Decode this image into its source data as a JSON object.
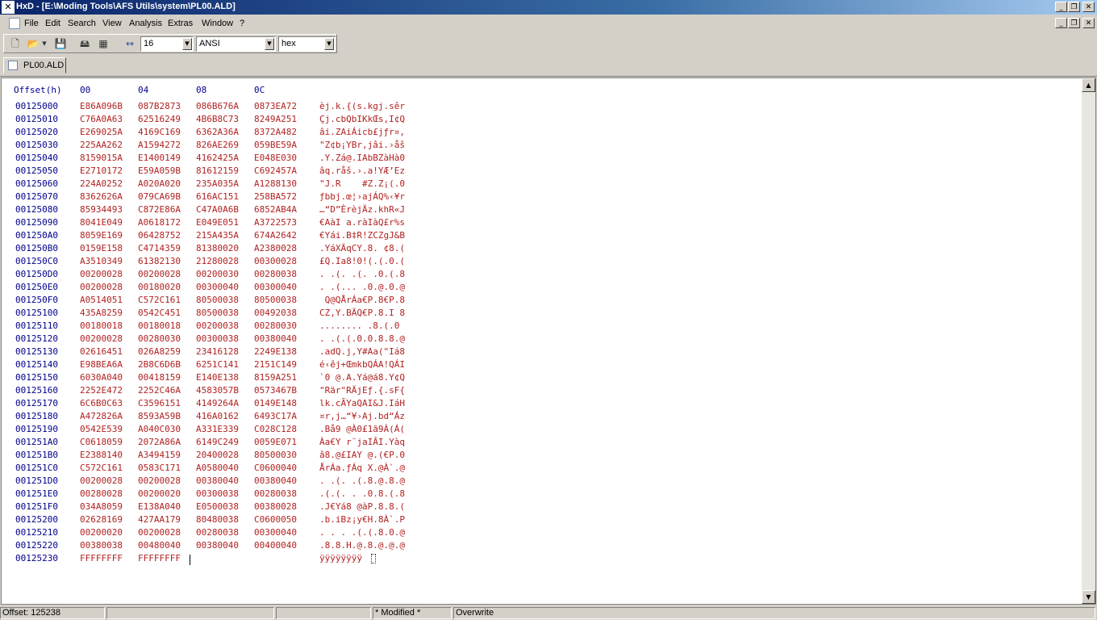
{
  "window": {
    "title": "HxD - [E:\\Moding Tools\\AFS Utils\\system\\PL00.ALD]",
    "app_icon": "hxd-icon"
  },
  "menu": [
    "File",
    "Edit",
    "Search",
    "View",
    "Analysis",
    "Extras",
    "Window",
    "?"
  ],
  "toolbar": {
    "bytes_per_row": "16",
    "charset": "ANSI",
    "offset_base": "hex"
  },
  "tab": {
    "label": "PL00.ALD"
  },
  "editor": {
    "header": {
      "offset": "Offset(h)",
      "cols": [
        "00",
        "04",
        "08",
        "0C"
      ]
    },
    "rows": [
      {
        "o": "00125000",
        "h": [
          "E86A096B",
          "087B2873",
          "086B676A",
          "0873EA72"
        ],
        "t": "èj.k.{(s.kgj.sêr"
      },
      {
        "o": "00125010",
        "h": [
          "C76A0A63",
          "62516249",
          "4B6B8C73",
          "8249A251"
        ],
        "t": "Çj.cbQbIKkŒs‚I¢Q"
      },
      {
        "o": "00125020",
        "h": [
          "E269025A",
          "4169C169",
          "6362A36A",
          "8372A482"
        ],
        "t": "âi.ZAiÁicb£jƒr¤‚"
      },
      {
        "o": "00125030",
        "h": [
          "225AA262",
          "A1594272",
          "826AE269",
          "059BE59A"
        ],
        "t": "\"Z¢b¡YBr‚jâi.›åš"
      },
      {
        "o": "00125040",
        "h": [
          "8159015A",
          "E1400149",
          "4162425A",
          "E048E030"
        ],
        "t": ".Y.Zá@.IAbBZàHà0"
      },
      {
        "o": "00125050",
        "h": [
          "E2710172",
          "E59A059B",
          "81612159",
          "C692457A"
        ],
        "t": "âq.råš.›.a!YÆ’Ez"
      },
      {
        "o": "00125060",
        "h": [
          "224A0252",
          "A020A020",
          "235A035A",
          "A1288130"
        ],
        "t": "\"J.R    #Z.Z¡(.0"
      },
      {
        "o": "00125070",
        "h": [
          "8362626A",
          "079CA69B",
          "616AC151",
          "258BA572"
        ],
        "t": "ƒbbj.œ¦›ajÁQ%‹¥r"
      },
      {
        "o": "00125080",
        "h": [
          "85934493",
          "C872E86A",
          "C47A0A6B",
          "6852AB4A"
        ],
        "t": "…“D”ÈrèjÄz.khR«J"
      },
      {
        "o": "00125090",
        "h": [
          "8041E049",
          "A0618172",
          "E049E051",
          "A3722573"
        ],
        "t": "€AàI a.ràIàQ£r%s"
      },
      {
        "o": "001250A0",
        "h": [
          "8059E169",
          "06428752",
          "215A435A",
          "674A2642"
        ],
        "t": "€Yái.B‡R!ZCZgJ&B"
      },
      {
        "o": "001250B0",
        "h": [
          "0159E158",
          "C4714359",
          "81380020",
          "A2380028"
        ],
        "t": ".YáXÄqCY.8. ¢8.("
      },
      {
        "o": "001250C0",
        "h": [
          "A3510349",
          "61382130",
          "21280028",
          "00300028"
        ],
        "t": "£Q.Ia8!0!(.(.0.("
      },
      {
        "o": "001250D0",
        "h": [
          "00200028",
          "00200028",
          "00200030",
          "00280038"
        ],
        "t": ". .(. .(. .0.(.8"
      },
      {
        "o": "001250E0",
        "h": [
          "00200028",
          "00180020",
          "00300040",
          "00300040"
        ],
        "t": ". .(... .0.@.0.@"
      },
      {
        "o": "001250F0",
        "h": [
          "A0514051",
          "C572C161",
          "80500038",
          "80500038"
        ],
        "t": " Q@QÅrÁa€P.8€P.8"
      },
      {
        "o": "00125100",
        "h": [
          "435A8259",
          "0542C451",
          "80500038",
          "00492038"
        ],
        "t": "CZ‚Y.BÄQ€P.8.I 8"
      },
      {
        "o": "00125110",
        "h": [
          "00180018",
          "00180018",
          "00200038",
          "00280030"
        ],
        "t": "........ .8.(.0"
      },
      {
        "o": "00125120",
        "h": [
          "00200028",
          "00280030",
          "00300038",
          "00380040"
        ],
        "t": ". .(.(.0.0.8.8.@"
      },
      {
        "o": "00125130",
        "h": [
          "02616451",
          "026A8259",
          "23416128",
          "2249E138"
        ],
        "t": ".adQ.j‚Y#Aa(\"Iá8"
      },
      {
        "o": "00125140",
        "h": [
          "E98BEA6A",
          "2B8C6D6B",
          "6251C141",
          "2151C149"
        ],
        "t": "é‹êj+ŒmkbQÁA!QÁI"
      },
      {
        "o": "00125150",
        "h": [
          "6030A040",
          "00418159",
          "E140E138",
          "8159A251"
        ],
        "t": "`0 @.A.Yá@á8.Y¢Q"
      },
      {
        "o": "00125160",
        "h": [
          "2252E472",
          "2252C46A",
          "4583057B",
          "0573467B"
        ],
        "t": "\"Rär\"RÄjEƒ.{.sF{"
      },
      {
        "o": "00125170",
        "h": [
          "6C6B0C63",
          "C3596151",
          "4149264A",
          "0149E148"
        ],
        "t": "lk.cÃYaQAI&J.IáH"
      },
      {
        "o": "00125180",
        "h": [
          "A472826A",
          "8593A59B",
          "416A0162",
          "6493C17A"
        ],
        "t": "¤r‚j…“¥›Aj.bd“Áz"
      },
      {
        "o": "00125190",
        "h": [
          "0542E539",
          "A040C030",
          "A331E339",
          "C028C128"
        ],
        "t": ".Bå9 @À0£1ã9À(Á("
      },
      {
        "o": "001251A0",
        "h": [
          "C0618059",
          "2072A86A",
          "6149C249",
          "0059E071"
        ],
        "t": "Àa€Y r¨jaIÂI.Yàq"
      },
      {
        "o": "001251B0",
        "h": [
          "E2388140",
          "A3494159",
          "20400028",
          "80500030"
        ],
        "t": "â8.@£IAY @.(€P.0"
      },
      {
        "o": "001251C0",
        "h": [
          "C572C161",
          "0583C171",
          "A0580040",
          "C0600040"
        ],
        "t": "ÅrÁa.ƒÁq X.@À`.@"
      },
      {
        "o": "001251D0",
        "h": [
          "00200028",
          "00200028",
          "00380040",
          "00380040"
        ],
        "t": ". .(. .(.8.@.8.@"
      },
      {
        "o": "001251E0",
        "h": [
          "00280028",
          "00200020",
          "00300038",
          "00280038"
        ],
        "t": ".(.(. . .0.8.(.8"
      },
      {
        "o": "001251F0",
        "h": [
          "034A8059",
          "E138A040",
          "E0500038",
          "00380028"
        ],
        "t": ".J€Yá8 @àP.8.8.("
      },
      {
        "o": "00125200",
        "h": [
          "02628169",
          "427AA179",
          "80480038",
          "C0600050"
        ],
        "t": ".b.iBz¡y€H.8À`.P"
      },
      {
        "o": "00125210",
        "h": [
          "00200020",
          "00200028",
          "00280038",
          "00300040"
        ],
        "t": ". . . .(.(.8.0.@"
      },
      {
        "o": "00125220",
        "h": [
          "00380038",
          "00480040",
          "00380040",
          "00400040"
        ],
        "t": ".8.8.H.@.8.@.@.@"
      },
      {
        "o": "00125230",
        "h": [
          "FFFFFFFF",
          "FFFFFFFF",
          "",
          ""
        ],
        "t": "ÿÿÿÿÿÿÿÿ"
      }
    ]
  },
  "status": {
    "offset": "Offset: 125238",
    "modified": "* Modified *",
    "mode": "Overwrite"
  }
}
